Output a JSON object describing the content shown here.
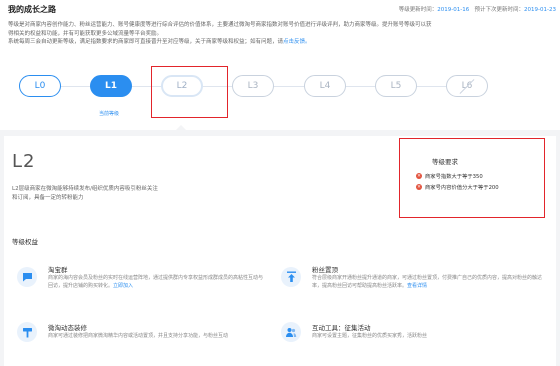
{
  "header": {
    "title": "我的成长之路",
    "update_label": "等级更新时间：",
    "update_date": "2019-01-16",
    "next_label": "预计下次更新时间：",
    "next_date": "2019-01-23"
  },
  "description": {
    "line1": "等级是对商家内容创作能力、粉丝运营能力、账号健康度等进行综合评估的价值体系，主要通过微淘号商家指数对账号价值进行评级评判，助力商家等级。提升账号等级可以获",
    "line2": "得相关的权益和功能，并有可能获取更多公域流量等平台奖励。",
    "line3_prefix": "系统每周三会自动更新等级，满足指数要求的商家即可直接晋升至对应等级，关于商家等级和权益；如有问题，请",
    "link_text": "点击反馈。"
  },
  "levels": {
    "items": [
      {
        "label": "L0",
        "state": "passed"
      },
      {
        "label": "L1",
        "state": "current"
      },
      {
        "label": "L2",
        "state": "selected"
      },
      {
        "label": "L3",
        "state": "locked"
      },
      {
        "label": "L4",
        "state": "locked"
      },
      {
        "label": "L5",
        "state": "locked"
      },
      {
        "label": "L6",
        "state": "locked"
      }
    ],
    "current_label": "当前等级"
  },
  "detail": {
    "level": "L2",
    "desc": "L2层级商家在微淘能够持续发布/组织优质内容吸引粉丝关注和订阅，具备一定的转粉能力",
    "requirements_title": "等级要求",
    "requirements": [
      "商家号指数大于等于350",
      "商家号内容价值分大于等于200"
    ]
  },
  "benefits": {
    "title": "等级权益",
    "items": [
      {
        "icon": "chat-group-icon",
        "title": "淘宝群",
        "desc": "商家的海内容会员及粉丝的实时在线运营阵地，通过提供群内专享权益形成群成员的高粘性互动与回访，提升店铺的购买转化。",
        "link": "立即加入"
      },
      {
        "icon": "pin-top-icon",
        "title": "粉丝置顶",
        "desc": "符合层级商家开通粉丝提升通道的商家，可通过粉丝置顶，付费推广自己的优质内容，提高对粉丝的触达率，提高粉丝回访可帮助提高粉丝活跃率。",
        "link": "查看详情"
      },
      {
        "icon": "brush-icon",
        "title": "微淘动态装修",
        "desc": "商家可通过装修把商家微淘精华内容或活动置顶，并且支持分享功能，与粉丝互动",
        "link": ""
      },
      {
        "icon": "people-icon",
        "title": "互动工具：征集活动",
        "desc": "商家可设置主题，征集粉丝的优质买家秀，活跃粉丝",
        "link": ""
      }
    ]
  },
  "colors": {
    "accent": "#2b8ef0",
    "highlight_border": "#e2252b",
    "requirement_fail": "#e2523d"
  }
}
